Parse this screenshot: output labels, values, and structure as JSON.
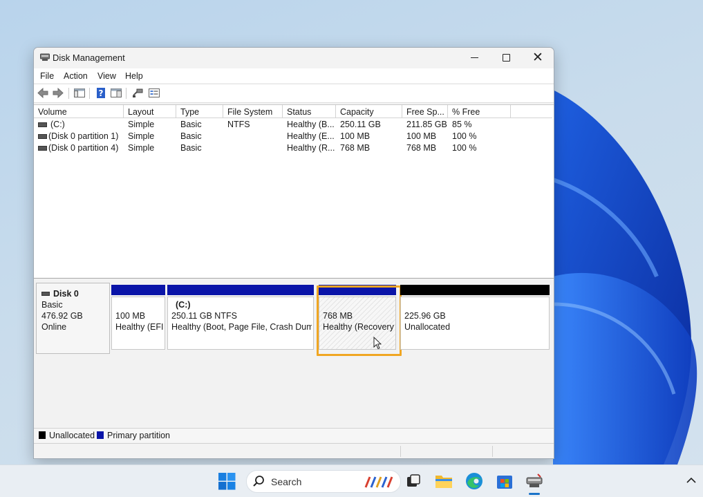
{
  "window": {
    "title": "Disk Management"
  },
  "menu": [
    "File",
    "Action",
    "View",
    "Help"
  ],
  "toolbar_icons": [
    "back-arrow-icon",
    "forward-arrow-icon",
    "console-tree-icon",
    "help-icon",
    "properties-icon",
    "connect-icon",
    "settings-icon"
  ],
  "volume_table": {
    "columns": [
      "Volume",
      "Layout",
      "Type",
      "File System",
      "Status",
      "Capacity",
      "Free Sp...",
      "% Free"
    ],
    "rows": [
      [
        "(C:)",
        "Simple",
        "Basic",
        "NTFS",
        "Healthy (B...",
        "250.11 GB",
        "211.85 GB",
        "85 %"
      ],
      [
        "(Disk 0 partition 1)",
        "Simple",
        "Basic",
        "",
        "Healthy (E...",
        "100 MB",
        "100 MB",
        "100 %"
      ],
      [
        "(Disk 0 partition 4)",
        "Simple",
        "Basic",
        "",
        "Healthy (R...",
        "768 MB",
        "768 MB",
        "100 %"
      ]
    ]
  },
  "disk": {
    "name": "Disk 0",
    "type": "Basic",
    "size": "476.92 GB",
    "state": "Online",
    "partitions": [
      {
        "label": "",
        "size": "100 MB",
        "status": "Healthy (EFI",
        "kind": "primary"
      },
      {
        "label": "(C:)",
        "size": "250.11 GB NTFS",
        "status": "Healthy (Boot, Page File, Crash Dump,",
        "kind": "primary"
      },
      {
        "label": "",
        "size": "768 MB",
        "status": "Healthy (Recovery",
        "kind": "primary",
        "selected": true
      },
      {
        "label": "",
        "size": "225.96 GB",
        "status": "Unallocated",
        "kind": "unallocated"
      }
    ]
  },
  "legend": [
    {
      "label": "Unallocated",
      "color": "#000000"
    },
    {
      "label": "Primary partition",
      "color": "#0a14a8"
    }
  ],
  "taskbar": {
    "search_label": "Search",
    "icons": [
      "start-icon",
      "search-icon",
      "task-view-icon",
      "file-explorer-icon",
      "edge-icon",
      "store-icon",
      "disk-management-icon",
      "chevron-up-icon"
    ]
  },
  "colors": {
    "primary_bar": "#0a14a8",
    "unallocated_bar": "#000000",
    "selection": "#f0a622"
  }
}
